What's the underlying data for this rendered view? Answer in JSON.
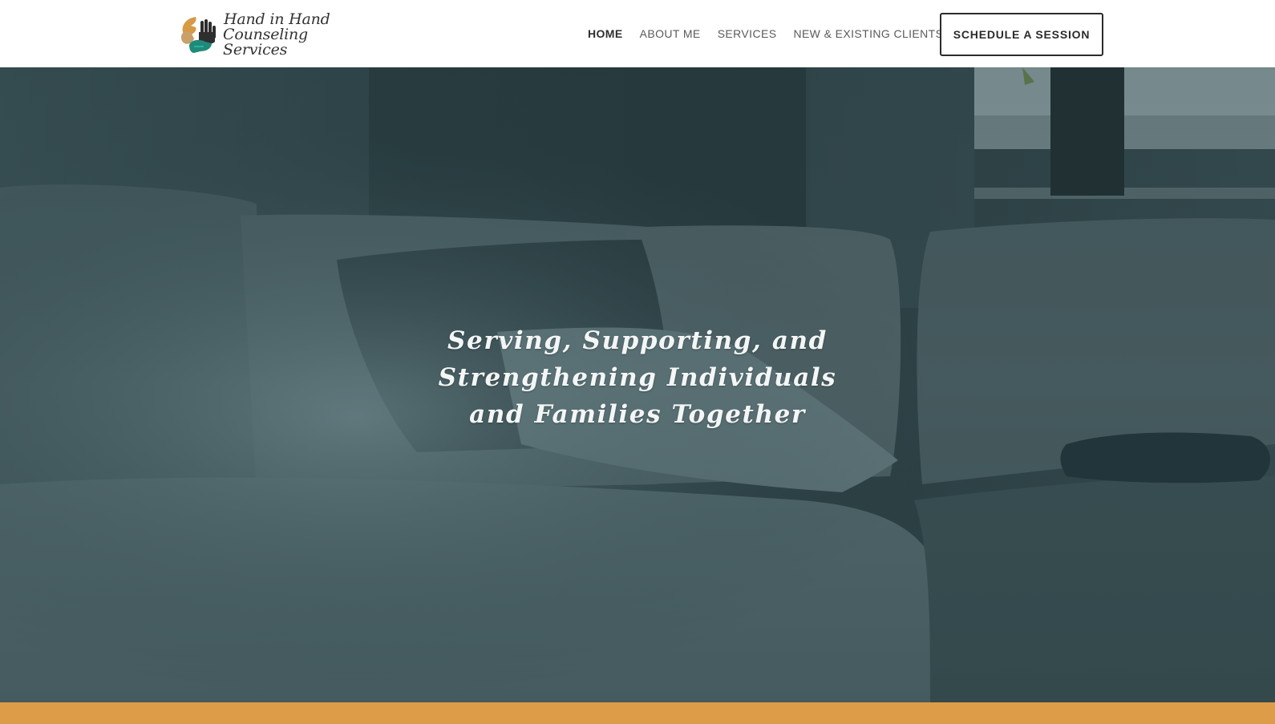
{
  "brand": {
    "logo_line1": "Hand in Hand",
    "logo_line2": "Counseling Services",
    "colors": {
      "orange": "#dd9c48",
      "teal": "#1f8a7a",
      "tan": "#c9a06a",
      "dark": "#2e2e2e"
    }
  },
  "nav": {
    "items": [
      {
        "label": "HOME",
        "active": true
      },
      {
        "label": "ABOUT ME",
        "active": false
      },
      {
        "label": "SERVICES",
        "active": false
      },
      {
        "label": "NEW & EXISTING CLIENTS",
        "active": false
      }
    ],
    "cta_label": "SCHEDULE A SESSION"
  },
  "hero": {
    "headline_line1": "Serving, Supporting, and",
    "headline_line2": "Strengthening Individuals",
    "headline_line3": "and Families Together",
    "background": "teal-tinted photo of a sofa with pillows by a window",
    "tint_color": "#2f4448"
  },
  "footer_band": {
    "color": "#dd9c48"
  }
}
